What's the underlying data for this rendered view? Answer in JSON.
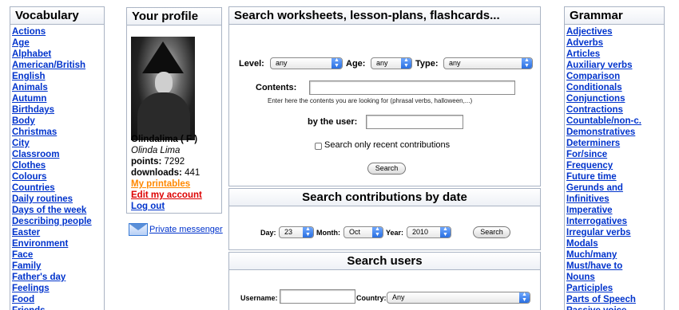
{
  "vocabulary": {
    "title": "Vocabulary",
    "items": [
      "Actions",
      "Age",
      "Alphabet",
      "American/British",
      "English",
      "Animals",
      "Autumn",
      "Birthdays",
      "Body",
      "Christmas",
      "City",
      "Classroom",
      "Clothes",
      "Colours",
      "Countries",
      "Daily routines",
      "Days of the week",
      "Describing people",
      "Easter",
      "Environment",
      "Face",
      "Family",
      "Father's day",
      "Feelings",
      "Food",
      "Friends"
    ]
  },
  "profile": {
    "title": "Your profile",
    "username": "Olindalima ( F )",
    "realname": "Olinda Lima",
    "points_label": "points:",
    "points": "7292",
    "downloads_label": "downloads:",
    "downloads": "441",
    "my_printables": "My printables",
    "edit_account": "Edit my account",
    "logout": "Log out",
    "messenger": "Private messenger"
  },
  "search": {
    "title": "Search worksheets, lesson-plans, flashcards...",
    "level_label": "Level:",
    "level_value": "any",
    "age_label": "Age:",
    "age_value": "any",
    "type_label": "Type:",
    "type_value": "any",
    "contents_label": "Contents:",
    "contents_hint": "Enter here the contents you are looking for (phrasal verbs, halloween,...)",
    "user_label": "by the user:",
    "recent_label": "Search only recent contributions",
    "button": "Search"
  },
  "by_date": {
    "title": "Search contributions by date",
    "day_label": "Day:",
    "day_value": "23",
    "month_label": "Month:",
    "month_value": "Oct",
    "year_label": "Year:",
    "year_value": "2010",
    "button": "Search"
  },
  "users": {
    "title": "Search users",
    "username_label": "Username:",
    "country_label": "Country:",
    "country_value": "Any"
  },
  "grammar": {
    "title": "Grammar",
    "items": [
      "Adjectives",
      "Adverbs",
      "Articles",
      "Auxiliary verbs",
      "Comparison",
      "Conditionals",
      "Conjunctions",
      "Contractions",
      "Countable/non-c.",
      "Demonstratives",
      "Determiners",
      "For/since",
      "Frequency",
      "Future time",
      "Gerunds and",
      "Infinitives",
      "Imperative",
      "Interrogatives",
      "Irregular verbs",
      "Modals",
      "Much/many",
      "Must/have to",
      "Nouns",
      "Participles",
      "Parts of Speech",
      "Passive voice"
    ]
  }
}
